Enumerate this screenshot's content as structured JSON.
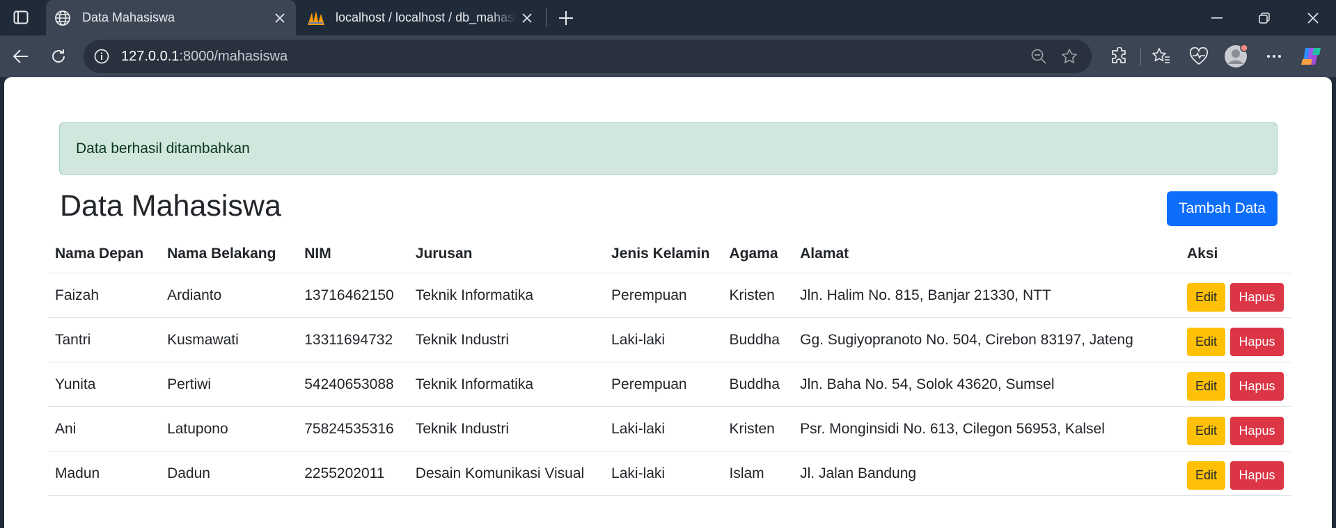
{
  "browser": {
    "tabs": [
      {
        "title": "Data Mahasiswa",
        "active": true,
        "icon": "globe-icon"
      },
      {
        "title": "localhost / localhost / db_mahasiswa",
        "active": false,
        "icon": "phpmyadmin-icon"
      }
    ],
    "address": {
      "host": "127.0.0.1",
      "path": ":8000/mahasiswa"
    }
  },
  "alert": {
    "text": "Data berhasil ditambahkan"
  },
  "page": {
    "title": "Data Mahasiswa",
    "add_button": "Tambah Data"
  },
  "table": {
    "headers": [
      "Nama Depan",
      "Nama Belakang",
      "NIM",
      "Jurusan",
      "Jenis Kelamin",
      "Agama",
      "Alamat",
      "Aksi"
    ],
    "rows": [
      [
        "Faizah",
        "Ardianto",
        "13716462150",
        "Teknik Informatika",
        "Perempuan",
        "Kristen",
        "Jln. Halim No. 815, Banjar 21330, NTT"
      ],
      [
        "Tantri",
        "Kusmawati",
        "13311694732",
        "Teknik Industri",
        "Laki-laki",
        "Buddha",
        "Gg. Sugiyopranoto No. 504, Cirebon 83197, Jateng"
      ],
      [
        "Yunita",
        "Pertiwi",
        "54240653088",
        "Teknik Informatika",
        "Perempuan",
        "Buddha",
        "Jln. Baha No. 54, Solok 43620, Sumsel"
      ],
      [
        "Ani",
        "Latupono",
        "75824535316",
        "Teknik Industri",
        "Laki-laki",
        "Kristen",
        "Psr. Monginsidi No. 613, Cilegon 56953, Kalsel"
      ],
      [
        "Madun",
        "Dadun",
        "2255202011",
        "Desain Komunikasi Visual",
        "Laki-laki",
        "Islam",
        "Jl. Jalan Bandung"
      ]
    ],
    "edit_label": "Edit",
    "delete_label": "Hapus"
  },
  "colors": {
    "primary": "#0d6efd",
    "warning": "#ffc107",
    "danger": "#dc3545",
    "success_bg": "#d1e7dd",
    "chrome_bg": "#202b39"
  }
}
